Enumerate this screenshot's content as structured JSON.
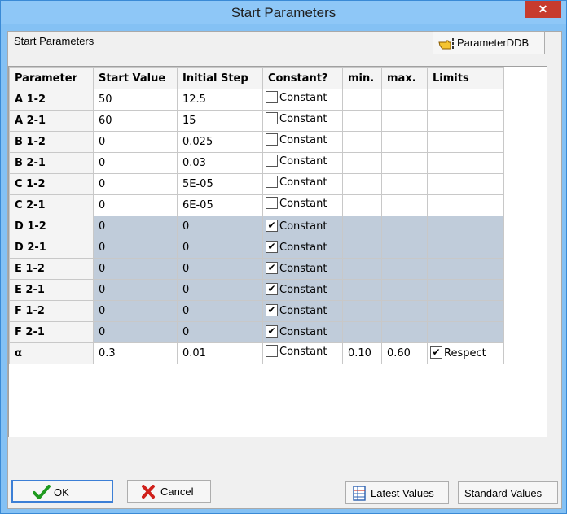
{
  "window": {
    "title": "Start Parameters",
    "close_label": "✕"
  },
  "header": {
    "label": "Start Parameters",
    "ddb_button": "ParameterDDB",
    "ddb_icon": "pointing-hand-icon"
  },
  "table": {
    "columns": [
      "Parameter",
      "Start Value",
      "Initial Step",
      "Constant?",
      "min.",
      "max.",
      "Limits"
    ],
    "rows": [
      {
        "name": "A 1-2",
        "start": "50",
        "step": "12.5",
        "constant_label": "Constant",
        "constant": false,
        "min": "",
        "max": "",
        "limits": ""
      },
      {
        "name": "A 2-1",
        "start": "60",
        "step": "15",
        "constant_label": "Constant",
        "constant": false,
        "min": "",
        "max": "",
        "limits": ""
      },
      {
        "name": "B 1-2",
        "start": "0",
        "step": "0.025",
        "constant_label": "Constant",
        "constant": false,
        "min": "",
        "max": "",
        "limits": ""
      },
      {
        "name": "B 2-1",
        "start": "0",
        "step": "0.03",
        "constant_label": "Constant",
        "constant": false,
        "min": "",
        "max": "",
        "limits": ""
      },
      {
        "name": "C 1-2",
        "start": "0",
        "step": "5E-05",
        "constant_label": "Constant",
        "constant": false,
        "min": "",
        "max": "",
        "limits": ""
      },
      {
        "name": "C 2-1",
        "start": "0",
        "step": "6E-05",
        "constant_label": "Constant",
        "constant": false,
        "min": "",
        "max": "",
        "limits": ""
      },
      {
        "name": "D 1-2",
        "start": "0",
        "step": "0",
        "constant_label": "Constant",
        "constant": true,
        "min": "",
        "max": "",
        "limits": ""
      },
      {
        "name": "D 2-1",
        "start": "0",
        "step": "0",
        "constant_label": "Constant",
        "constant": true,
        "min": "",
        "max": "",
        "limits": ""
      },
      {
        "name": "E 1-2",
        "start": "0",
        "step": "0",
        "constant_label": "Constant",
        "constant": true,
        "min": "",
        "max": "",
        "limits": ""
      },
      {
        "name": "E 2-1",
        "start": "0",
        "step": "0",
        "constant_label": "Constant",
        "constant": true,
        "min": "",
        "max": "",
        "limits": ""
      },
      {
        "name": "F 1-2",
        "start": "0",
        "step": "0",
        "constant_label": "Constant",
        "constant": true,
        "min": "",
        "max": "",
        "limits": ""
      },
      {
        "name": "F 2-1",
        "start": "0",
        "step": "0",
        "constant_label": "Constant",
        "constant": true,
        "min": "",
        "max": "",
        "limits": ""
      },
      {
        "name": "α",
        "start": "0.3",
        "step": "0.01",
        "constant_label": "Constant",
        "constant": false,
        "min": "0.10",
        "max": "0.60",
        "limits": "Respect",
        "limits_checked": true
      }
    ]
  },
  "footer": {
    "ok": "OK",
    "ok_icon": "green-check-icon",
    "cancel": "Cancel",
    "cancel_icon": "red-x-icon",
    "latest": "Latest Values",
    "latest_icon": "table-icon",
    "standard": "Standard Values"
  },
  "colors": {
    "title_bar": "#8ec7f7",
    "close_button": "#c73b2d",
    "constant_row": "#c0ccda",
    "ok_border": "#3c7fd6"
  }
}
